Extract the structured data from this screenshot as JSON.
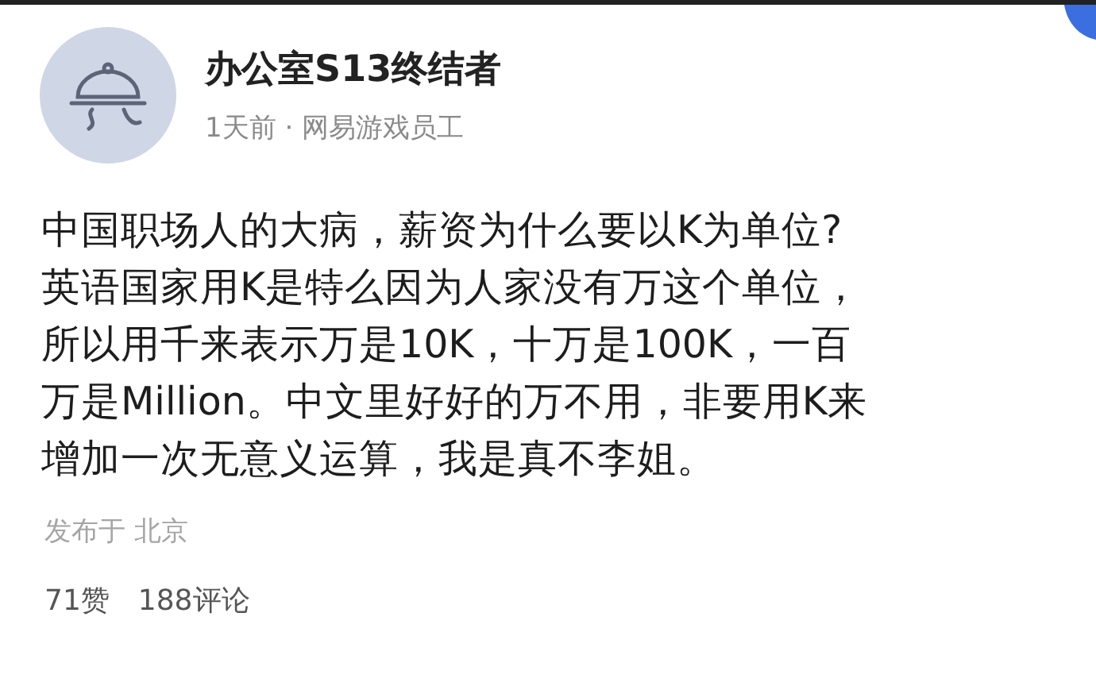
{
  "author": {
    "name": "办公室S13终结者",
    "meta": "1天前 · 网易游戏员工"
  },
  "post": {
    "lines": [
      "中国职场人的大病，薪资为什么要以K为单位?",
      "英语国家用K是特么因为人家没有万这个单位，",
      "所以用千来表示万是10K，十万是100K，一百",
      "万是Million。中文里好好的万不用，非要用K来",
      "增加一次无意义运算，我是真不李姐。"
    ],
    "location": "发布于 北京"
  },
  "stats": {
    "likes": "71赞",
    "comments": "188评论"
  }
}
